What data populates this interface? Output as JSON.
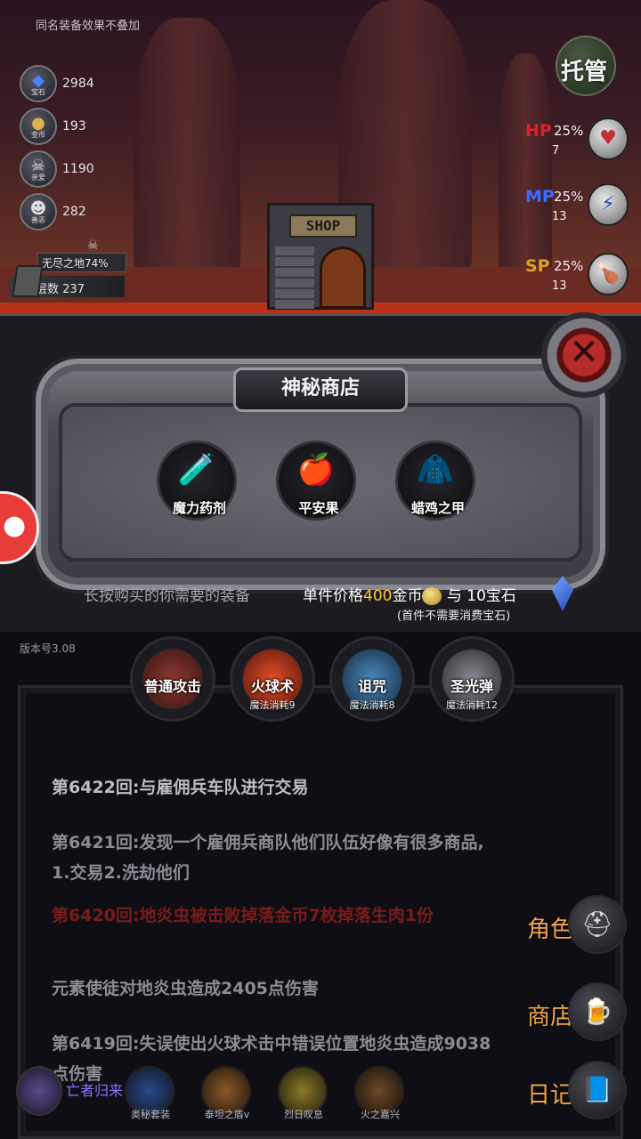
{
  "top_hint": "同名装备效果不叠加",
  "stats": [
    {
      "icon": "gem-icon",
      "sub": "宝石",
      "value": "2984"
    },
    {
      "icon": "gold-icon",
      "sub": "金币",
      "value": "193"
    },
    {
      "icon": "skull-icon",
      "sub": "亲爱",
      "value": "1190"
    },
    {
      "icon": "mask-icon",
      "sub": "善恶",
      "value": "282"
    }
  ],
  "depth": {
    "zone": "无尽之地74%",
    "floor": "层数 237"
  },
  "shop_sign": "SHOP",
  "auto_button": "托管",
  "resources": [
    {
      "name": "HP",
      "pct": "25%",
      "num": "7",
      "color": "#e0202a"
    },
    {
      "name": "MP",
      "pct": "25%",
      "num": "13",
      "color": "#3a6cff"
    },
    {
      "name": "SP",
      "pct": "25%",
      "num": "13",
      "color": "#e0a020"
    }
  ],
  "shop": {
    "title": "神秘商店",
    "items": [
      {
        "name": "魔力药剂",
        "art": "🧪"
      },
      {
        "name": "平安果",
        "art": "🍎"
      },
      {
        "name": "蜡鸡之甲",
        "art": "🧥"
      }
    ],
    "hint": "长按购买的你需要的装备",
    "price_prefix": "单件价格",
    "price_gold": "400",
    "price_gold_unit": "金币",
    "price_and": "与",
    "price_gem": "10",
    "price_gem_unit": "宝石",
    "price_note": "(首件不需要消费宝石)"
  },
  "version": "版本号3.08",
  "skills": [
    {
      "name": "普通攻击",
      "cost": "",
      "color": "#6a2a22"
    },
    {
      "name": "火球术",
      "cost": "魔法消耗9",
      "color": "#b8301a"
    },
    {
      "name": "诅咒",
      "cost": "魔法消耗8",
      "color": "#2a5a8a"
    },
    {
      "name": "圣光弹",
      "cost": "魔法消耗12",
      "color": "#4a4a52"
    }
  ],
  "logs": [
    {
      "text": "第6422回:与雇佣兵车队进行交易",
      "style": "first"
    },
    {
      "text": "第6421回:发现一个雇佣兵商队他们队伍好像有很多商品,",
      "style": "normal"
    },
    {
      "text": "1.交易2.洗劫他们",
      "style": "normal"
    },
    {
      "text": "第6420回:地炎虫被击败掉落金币7枚掉落生肉1份",
      "style": "red"
    },
    {
      "text": "元素使徒对地炎虫造成2405点伤害",
      "style": "normal"
    },
    {
      "text": "第6419回:失误使出火球术击中错误位置地炎虫造成9038",
      "style": "normal"
    },
    {
      "text": "点伤害",
      "style": "normal"
    }
  ],
  "menu": [
    {
      "label": "角色",
      "icon": "helmet-icon",
      "glyph": "⛑"
    },
    {
      "label": "商店",
      "icon": "beer-mug-icon",
      "glyph": "🍺"
    },
    {
      "label": "日记",
      "icon": "book-icon",
      "glyph": "📘"
    }
  ],
  "revive": {
    "name": "亡者归来"
  },
  "buffs": [
    {
      "name": "奥秘套装"
    },
    {
      "name": "泰坦之盾v"
    },
    {
      "name": "烈日叹息"
    },
    {
      "name": "火之嘉兴"
    }
  ]
}
